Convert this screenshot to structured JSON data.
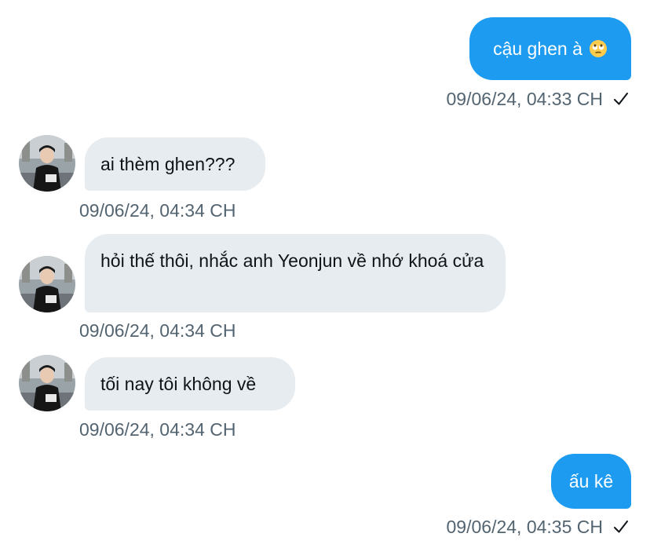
{
  "conversation": {
    "messages": [
      {
        "direction": "outgoing",
        "text": "cậu ghen à",
        "emoji": "face-with-rolling-eyes",
        "timestamp": "09/06/24, 04:33 CH",
        "status": "sent"
      },
      {
        "direction": "incoming",
        "text": "ai thèm ghen???",
        "timestamp": "09/06/24, 04:34 CH"
      },
      {
        "direction": "incoming",
        "text": "hỏi thế thôi, nhắc anh Yeonjun về nhớ khoá cửa",
        "timestamp": "09/06/24, 04:34 CH"
      },
      {
        "direction": "incoming",
        "text": "tối nay tôi không về",
        "timestamp": "09/06/24, 04:34 CH"
      },
      {
        "direction": "outgoing",
        "text": "ấu kê",
        "timestamp": "09/06/24, 04:35 CH",
        "status": "sent"
      }
    ]
  },
  "colors": {
    "outgoing_bubble": "#1d9bf0",
    "incoming_bubble": "#e7ecf0",
    "timestamp_text": "#536471"
  },
  "icons": {
    "status_sent": "check-icon",
    "avatar": "contact-avatar-photo"
  }
}
